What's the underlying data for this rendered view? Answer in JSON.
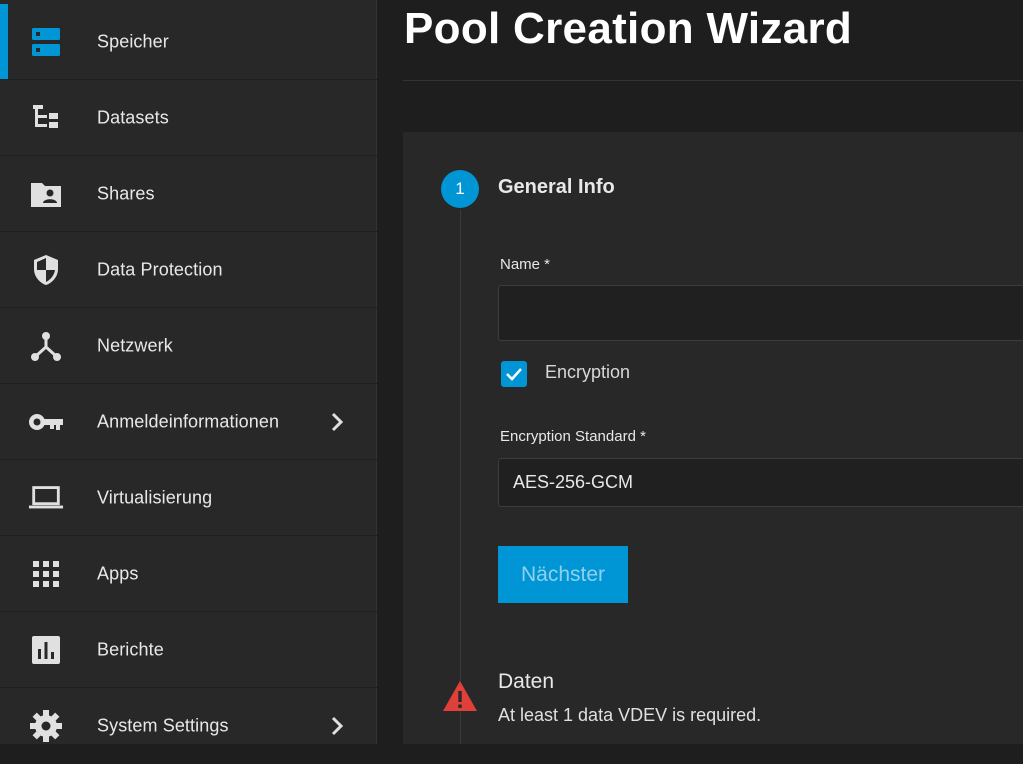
{
  "page": {
    "title": "Pool Creation Wizard"
  },
  "sidebar": {
    "items": [
      {
        "label": "Speicher",
        "icon": "storage-icon",
        "active": true
      },
      {
        "label": "Datasets",
        "icon": "dataset-tree-icon"
      },
      {
        "label": "Shares",
        "icon": "folder-share-icon"
      },
      {
        "label": "Data Protection",
        "icon": "shield-icon"
      },
      {
        "label": "Netzwerk",
        "icon": "network-icon"
      },
      {
        "label": "Anmeldeinformationen",
        "icon": "key-icon",
        "chevron": true
      },
      {
        "label": "Virtualisierung",
        "icon": "laptop-icon"
      },
      {
        "label": "Apps",
        "icon": "apps-grid-icon"
      },
      {
        "label": "Berichte",
        "icon": "bar-chart-icon"
      },
      {
        "label": "System Settings",
        "icon": "gear-icon",
        "chevron": true
      }
    ]
  },
  "wizard": {
    "step1": {
      "number": "1",
      "title": "General Info",
      "name_label": "Name *",
      "name_value": "",
      "encryption_label": "Encryption",
      "encryption_checked": true,
      "encryption_standard_label": "Encryption Standard *",
      "encryption_standard_value": "AES-256-GCM",
      "next_label": "Nächster"
    },
    "step2": {
      "title": "Daten",
      "message": "At least 1 data VDEV is required."
    }
  },
  "colors": {
    "accent": "#0095d5",
    "warning": "#e0403a",
    "sidebar_bg": "#282828",
    "page_bg": "#1e1e1e"
  }
}
